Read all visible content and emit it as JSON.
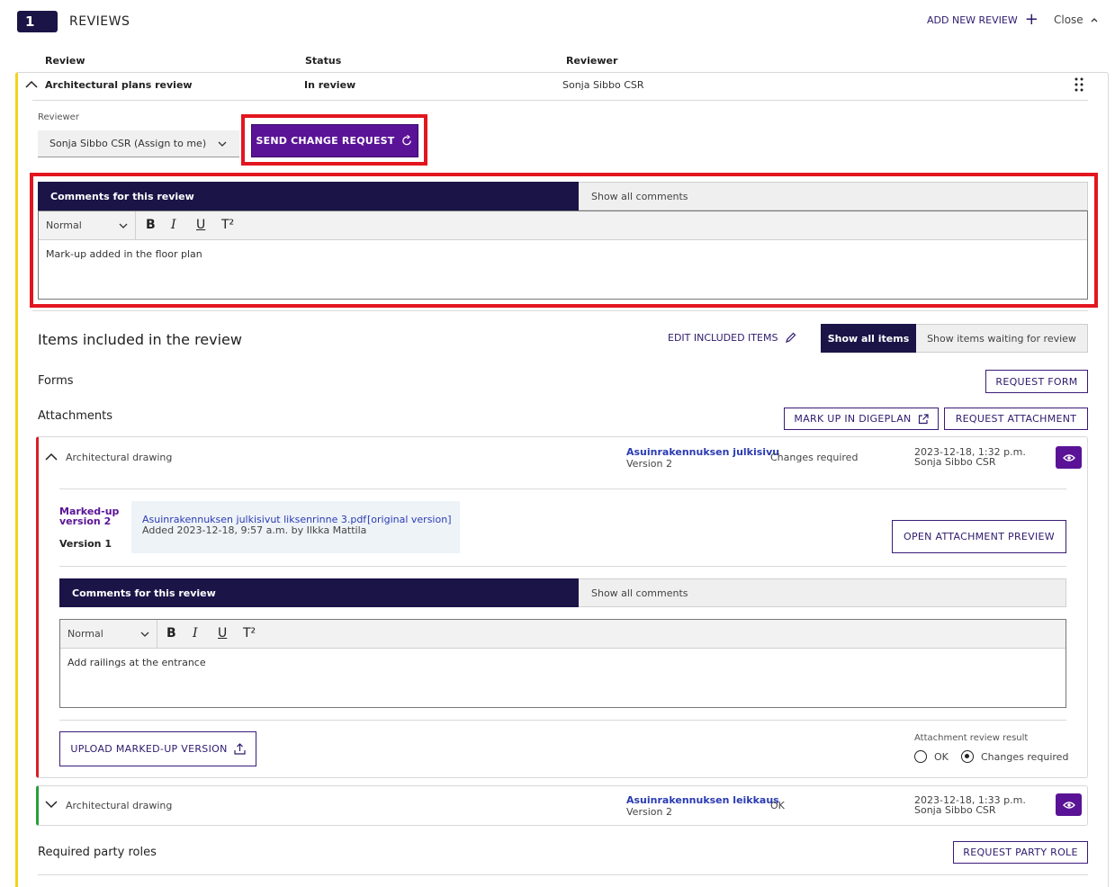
{
  "header": {
    "number": "1",
    "title": "REVIEWS",
    "add_new_review": "ADD NEW REVIEW",
    "close": "Close"
  },
  "table_headers": {
    "review": "Review",
    "status": "Status",
    "reviewer": "Reviewer"
  },
  "review_row": {
    "name": "Architectural plans review",
    "status": "In review",
    "reviewer": "Sonja Sibbo CSR"
  },
  "reviewer_select": {
    "label": "Reviewer",
    "value": "Sonja Sibbo CSR (Assign to me)"
  },
  "send_change_request": "SEND CHANGE REQUEST",
  "comments_panel_1": {
    "tab_active": "Comments for this review",
    "tab_inactive": "Show all comments",
    "format": "Normal",
    "text": "Mark-up added in the floor plan"
  },
  "items_section": {
    "title": "Items included in the review",
    "edit_included_items": "EDIT INCLUDED ITEMS",
    "show_all_items": "Show all items",
    "show_waiting": "Show items waiting for review"
  },
  "forms": {
    "label": "Forms",
    "request_form": "REQUEST FORM"
  },
  "attachments": {
    "label": "Attachments",
    "mark_up_digeplan": "MARK UP IN DIGEPLAN",
    "request_attachment": "REQUEST ATTACHMENT"
  },
  "attachment_1": {
    "type": "Architectural drawing",
    "file_link": "Asuinrakennuksen julkisivu",
    "version": "Version 2",
    "status": "Changes required",
    "date": "2023-12-18, 1:32 p.m.",
    "by": "Sonja Sibbo CSR",
    "marked_up_version": "Marked-up version 2",
    "version_1": "Version 1",
    "file_name": "Asuinrakennuksen julkisivut liksenrinne 3.pdf",
    "original_version": "[original version]",
    "added": "Added 2023-12-18, 9:57 a.m. by Ilkka Mattila",
    "open_preview": "OPEN ATTACHMENT PREVIEW",
    "upload_marked_up": "UPLOAD MARKED-UP VERSION",
    "review_result_label": "Attachment review result",
    "ok": "OK",
    "changes_required": "Changes required"
  },
  "comments_panel_2": {
    "tab_active": "Comments for this review",
    "tab_inactive": "Show all comments",
    "format": "Normal",
    "text": "Add railings at the entrance"
  },
  "attachment_2": {
    "type": "Architectural drawing",
    "file_link": "Asuinrakennuksen leikkaus",
    "version": "Version 2",
    "status": "OK",
    "date": "2023-12-18, 1:33 p.m.",
    "by": "Sonja Sibbo CSR"
  },
  "required_party_roles": {
    "label": "Required party roles",
    "request_party_role": "REQUEST PARTY ROLE"
  },
  "colors": {
    "navy": "#1b1447",
    "purple": "#5a1396",
    "yellow_bar": "#f2d21b",
    "red_bar": "#d81e2a",
    "green_bar": "#2a9d3a",
    "highlight_red": "#e3161f"
  }
}
